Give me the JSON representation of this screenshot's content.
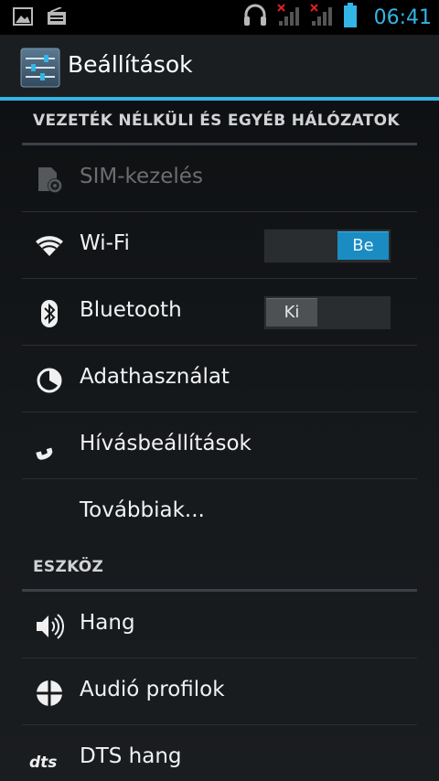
{
  "status_bar": {
    "time": "06:41",
    "icons": [
      "image-icon",
      "radio-icon",
      "headset-icon",
      "signal-no-service-icon",
      "signal-no-service-icon",
      "battery-icon"
    ]
  },
  "action_bar": {
    "title": "Beállítások",
    "icon": "settings-sliders-icon"
  },
  "colors": {
    "accent": "#33b5e5",
    "toggle_on": "#1b8cc2",
    "background": "#16191c"
  },
  "sections": [
    {
      "header": "VEZETÉK NÉLKÜLI ÉS EGYÉB HÁLÓZATOK",
      "items": [
        {
          "label": "SIM-kezelés",
          "icon": "sim-card-icon",
          "enabled": false
        },
        {
          "label": "Wi-Fi",
          "icon": "wifi-icon",
          "toggle": "Be",
          "toggle_state": "on"
        },
        {
          "label": "Bluetooth",
          "icon": "bluetooth-icon",
          "toggle": "Ki",
          "toggle_state": "off"
        },
        {
          "label": "Adathasználat",
          "icon": "data-usage-icon"
        },
        {
          "label": "Hívásbeállítások",
          "icon": "phone-handset-icon"
        },
        {
          "label": "Továbbiak...",
          "icon": ""
        }
      ]
    },
    {
      "header": "ESZKÖZ",
      "items": [
        {
          "label": "Hang",
          "icon": "speaker-icon"
        },
        {
          "label": "Audió profilok",
          "icon": "audio-profiles-icon"
        },
        {
          "label": "DTS hang",
          "icon": "dts-logo-icon"
        }
      ]
    }
  ]
}
